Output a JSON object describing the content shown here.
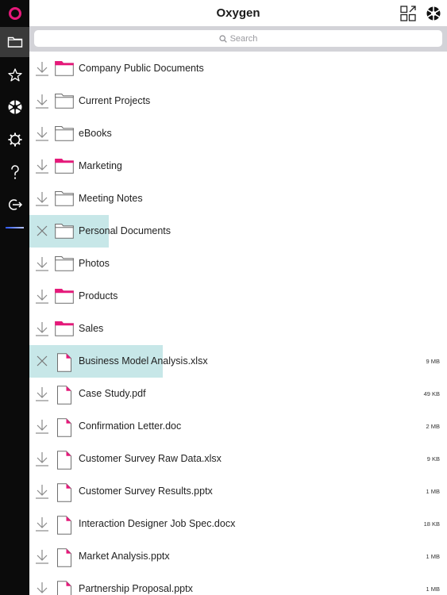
{
  "app": {
    "title": "Oxygen"
  },
  "sidebar": {
    "items": [
      {
        "name": "folders",
        "icon": "folder-icon",
        "active": true
      },
      {
        "name": "favorites",
        "icon": "star-icon"
      },
      {
        "name": "shutter",
        "icon": "aperture-icon"
      },
      {
        "name": "settings",
        "icon": "gear-icon"
      },
      {
        "name": "help",
        "icon": "question-icon"
      },
      {
        "name": "sign-out",
        "icon": "logout-icon"
      }
    ]
  },
  "header": {
    "right_icons": [
      "expand-grid-icon",
      "aperture-icon"
    ]
  },
  "search": {
    "placeholder": "Search"
  },
  "colors": {
    "accent_pink": "#e6197a",
    "highlight": "#c7e7e8",
    "rail_bg": "#0b0b0b"
  },
  "items": [
    {
      "type": "folder",
      "label": "Company Public Documents",
      "pink": true,
      "state": "download"
    },
    {
      "type": "folder",
      "label": "Current Projects",
      "pink": false,
      "state": "download"
    },
    {
      "type": "folder",
      "label": "eBooks",
      "pink": false,
      "state": "download"
    },
    {
      "type": "folder",
      "label": "Marketing",
      "pink": true,
      "state": "download"
    },
    {
      "type": "folder",
      "label": "Meeting Notes",
      "pink": false,
      "state": "download"
    },
    {
      "type": "folder",
      "label": "Personal Documents",
      "pink": false,
      "state": "downloading"
    },
    {
      "type": "folder",
      "label": "Photos",
      "pink": false,
      "state": "download"
    },
    {
      "type": "folder",
      "label": "Products",
      "pink": true,
      "state": "download"
    },
    {
      "type": "folder",
      "label": "Sales",
      "pink": true,
      "state": "download"
    },
    {
      "type": "file",
      "label": "Business Model Analysis.xlsx",
      "size": "9 MB",
      "state": "downloading"
    },
    {
      "type": "file",
      "label": "Case Study.pdf",
      "size": "49 KB",
      "state": "download"
    },
    {
      "type": "file",
      "label": "Confirmation Letter.doc",
      "size": "2 MB",
      "state": "download"
    },
    {
      "type": "file",
      "label": "Customer Survey Raw Data.xlsx",
      "size": "9 KB",
      "state": "download"
    },
    {
      "type": "file",
      "label": "Customer Survey Results.pptx",
      "size": "1 MB",
      "state": "download"
    },
    {
      "type": "file",
      "label": "Interaction Designer Job Spec.docx",
      "size": "18 KB",
      "state": "download"
    },
    {
      "type": "file",
      "label": "Market Analysis.pptx",
      "size": "1 MB",
      "state": "download"
    },
    {
      "type": "file",
      "label": "Partnership Proposal.pptx",
      "size": "1 MB",
      "state": "download"
    }
  ]
}
